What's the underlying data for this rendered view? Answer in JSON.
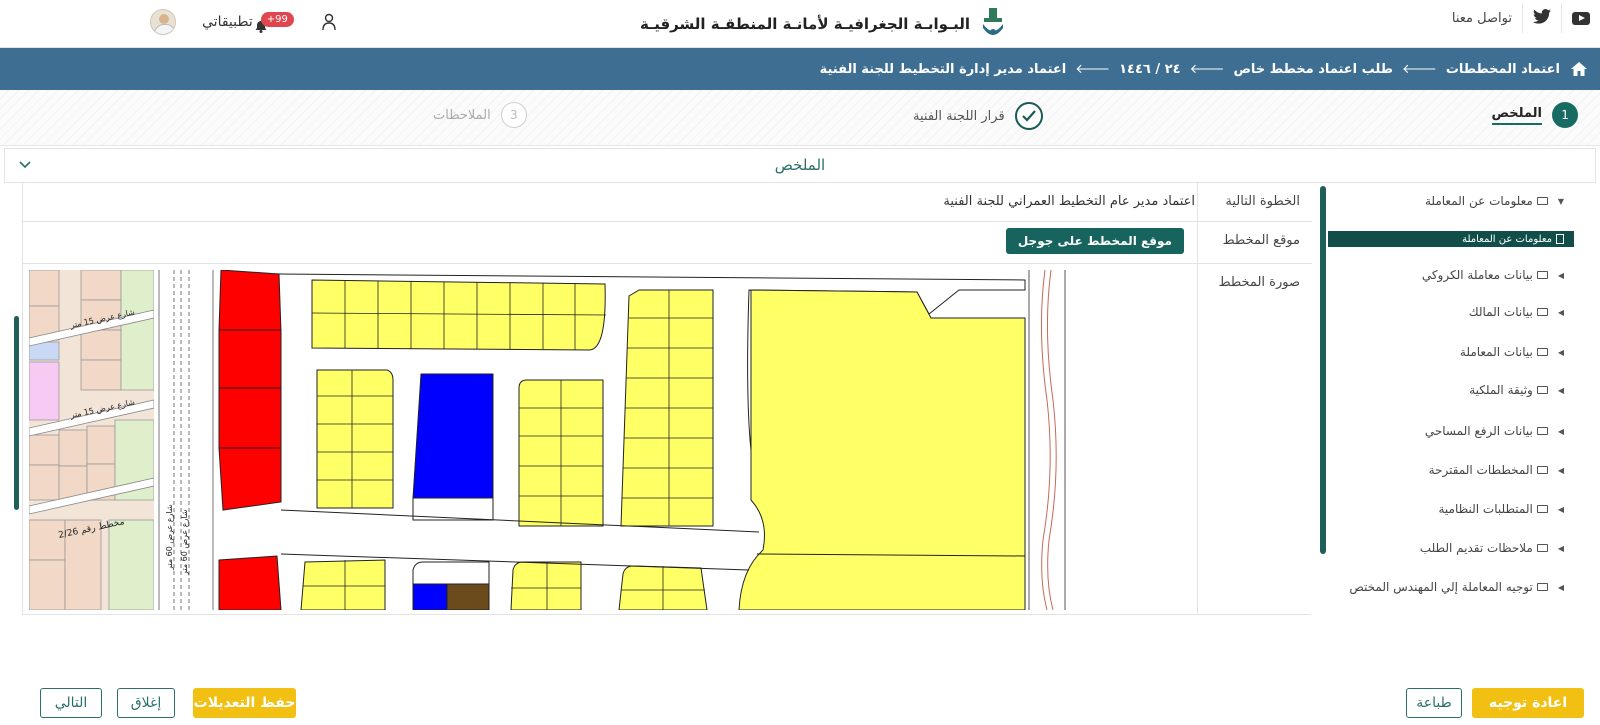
{
  "header": {
    "portal_title": "البـوابـة الجغرافيـة لأمانـة المنطقـة الشرقيـة",
    "contact_label": "تواصل معنا",
    "apps_label": "تطبيقاتي",
    "notifications_badge": "+99",
    "icons": [
      "youtube-icon",
      "twitter-icon",
      "user-icon",
      "bell-icon",
      "avatar"
    ]
  },
  "breadcrumb": {
    "items": [
      "اعتماد المخططات",
      "طلب اعتماد مخطط خاص",
      "٢٤ / ١٤٤٦",
      "اعتماد مدير إدارة التخطيط للجنة الفنية"
    ]
  },
  "stepper": {
    "steps": [
      {
        "number": "1",
        "label": "الملخص",
        "state": "active"
      },
      {
        "number": "",
        "label": "قرار اللجنة الفنية",
        "state": "done"
      },
      {
        "number": "3",
        "label": "الملاحظات",
        "state": "pending"
      }
    ]
  },
  "summary": {
    "title": "الملخص",
    "rows": {
      "next_step_label": "الخطوة التالية",
      "next_step_value": "اعتماد مدير عام التخطيط العمراني للجنة الفنية",
      "location_label": "موقع المخطط",
      "google_button": "موقع المخطط على جوجل",
      "image_label": "صورة المخطط"
    },
    "map_labels": {
      "street_15_a": "شارع عرض 15 متر",
      "street_15_b": "شارع عرض 15 متر",
      "street_60_a": "شارع عرض 60 متر",
      "street_60_b": "شارع عرض 60 متر",
      "plan_no": "مخطط رقم 2/26"
    }
  },
  "tree": {
    "root": "معلومات عن المعاملة",
    "selected": "معلومات عن المعاملة",
    "items": [
      "بيانات معاملة الكروكي",
      "بيانات المالك",
      "بيانات المعاملة",
      "وثيقة الملكية",
      "بيانات الرفع المساحي",
      "المخططات المقترحة",
      "المتطلبات النظامية",
      "ملاحظات تقديم الطلب",
      "توجيه المعاملة إلي المهندس المختص"
    ]
  },
  "footer": {
    "redirect": "اعادة توجيه",
    "print": "طباعة",
    "save": "حفظ التعديلات",
    "close": "إغلاق",
    "next": "التالي"
  },
  "colors": {
    "header_bar": "#3e6f92",
    "accent": "#176b62",
    "yellow": "#f2c013",
    "plot_yellow": "#ffff66",
    "plot_red": "#ff0000",
    "plot_blue": "#0000ff"
  }
}
